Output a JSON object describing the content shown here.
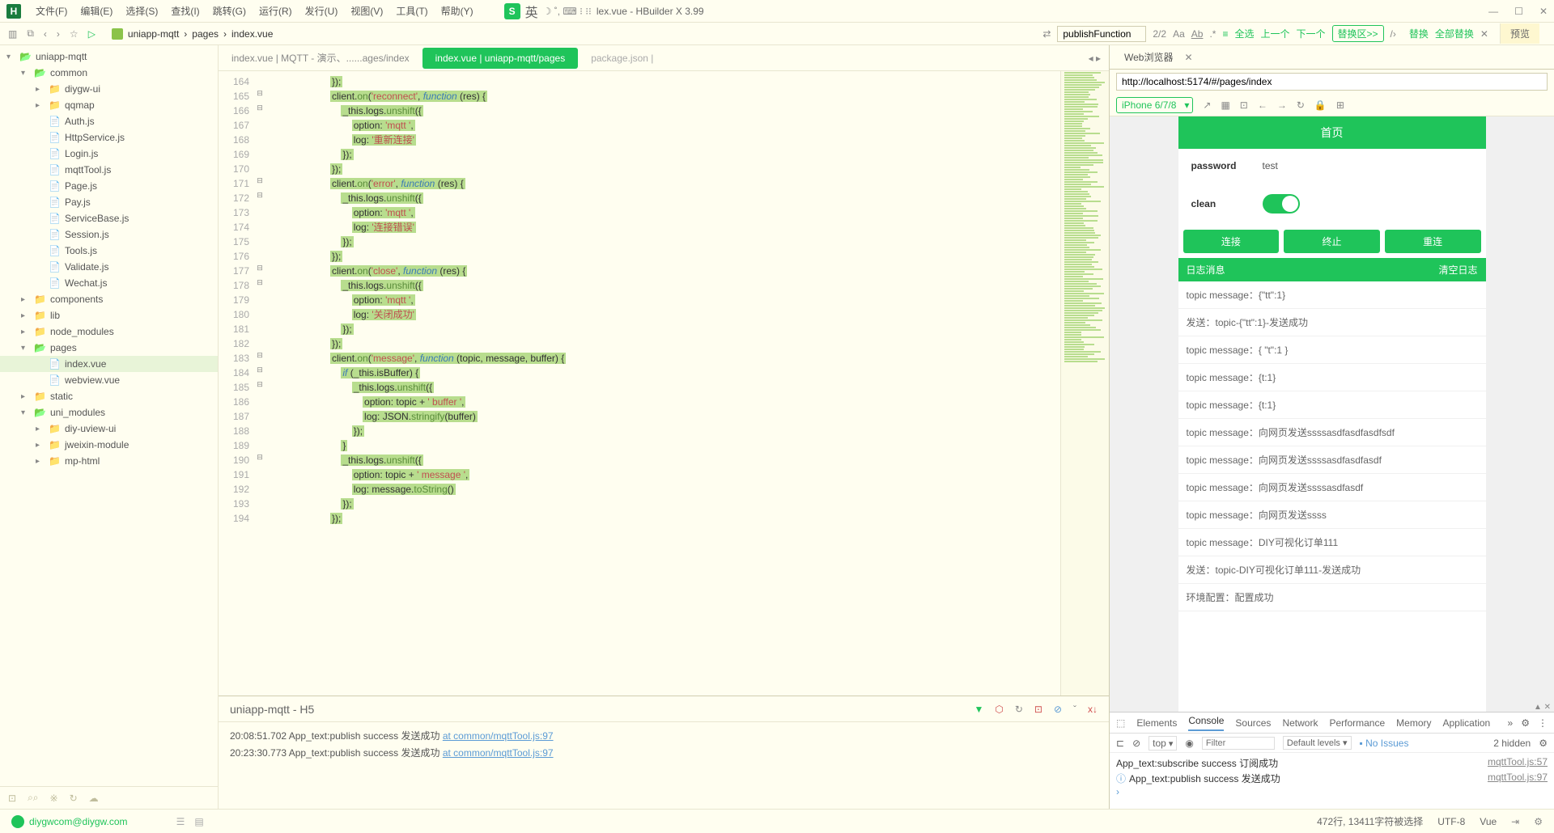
{
  "window": {
    "title": "lex.vue - HBuilder X 3.99"
  },
  "menus": [
    "文件(F)",
    "编辑(E)",
    "选择(S)",
    "查找(I)",
    "跳转(G)",
    "运行(R)",
    "发行(U)",
    "视图(V)",
    "工具(T)",
    "帮助(Y)"
  ],
  "ime": {
    "icon": "S",
    "lang": "英",
    "extras": "☽ ˚, ⌨ ⁝ ⁝⁝"
  },
  "breadcrumb": [
    "uniapp-mqtt",
    "pages",
    "index.vue"
  ],
  "find": {
    "term": "publishFunction",
    "count": "2/2",
    "ops": [
      "全选",
      "上一个",
      "下一个"
    ],
    "replace": "替换区>>",
    "actions": [
      "替换",
      "全部替换"
    ],
    "preview": "预览"
  },
  "tree": [
    {
      "d": 0,
      "c": "▾",
      "t": "folder-open",
      "l": "uniapp-mqtt"
    },
    {
      "d": 1,
      "c": "▾",
      "t": "folder-open",
      "l": "common"
    },
    {
      "d": 2,
      "c": "▸",
      "t": "folder-closed",
      "l": "diygw-ui"
    },
    {
      "d": 2,
      "c": "▸",
      "t": "folder-closed",
      "l": "qqmap"
    },
    {
      "d": 2,
      "c": "",
      "t": "file-js",
      "l": "Auth.js"
    },
    {
      "d": 2,
      "c": "",
      "t": "file-js",
      "l": "HttpService.js"
    },
    {
      "d": 2,
      "c": "",
      "t": "file-js",
      "l": "Login.js"
    },
    {
      "d": 2,
      "c": "",
      "t": "file-js",
      "l": "mqttTool.js"
    },
    {
      "d": 2,
      "c": "",
      "t": "file-js",
      "l": "Page.js"
    },
    {
      "d": 2,
      "c": "",
      "t": "file-js",
      "l": "Pay.js"
    },
    {
      "d": 2,
      "c": "",
      "t": "file-js",
      "l": "ServiceBase.js"
    },
    {
      "d": 2,
      "c": "",
      "t": "file-js",
      "l": "Session.js"
    },
    {
      "d": 2,
      "c": "",
      "t": "file-js",
      "l": "Tools.js"
    },
    {
      "d": 2,
      "c": "",
      "t": "file-js",
      "l": "Validate.js"
    },
    {
      "d": 2,
      "c": "",
      "t": "file-js",
      "l": "Wechat.js"
    },
    {
      "d": 1,
      "c": "▸",
      "t": "folder-closed",
      "l": "components"
    },
    {
      "d": 1,
      "c": "▸",
      "t": "folder-closed",
      "l": "lib"
    },
    {
      "d": 1,
      "c": "▸",
      "t": "folder-closed",
      "l": "node_modules"
    },
    {
      "d": 1,
      "c": "▾",
      "t": "folder-open",
      "l": "pages"
    },
    {
      "d": 2,
      "c": "",
      "t": "file-vue",
      "l": "index.vue",
      "active": true
    },
    {
      "d": 2,
      "c": "",
      "t": "file-vue",
      "l": "webview.vue"
    },
    {
      "d": 1,
      "c": "▸",
      "t": "folder-closed",
      "l": "static"
    },
    {
      "d": 1,
      "c": "▾",
      "t": "folder-open",
      "l": "uni_modules"
    },
    {
      "d": 2,
      "c": "▸",
      "t": "folder-closed",
      "l": "diy-uview-ui"
    },
    {
      "d": 2,
      "c": "▸",
      "t": "folder-closed",
      "l": "jweixin-module"
    },
    {
      "d": 2,
      "c": "▸",
      "t": "folder-closed",
      "l": "mp-html"
    }
  ],
  "tabs": [
    {
      "label": "index.vue | MQTT - 演示、......ages/index",
      "active": false
    },
    {
      "label": "index.vue | uniapp-mqtt/pages",
      "active": true
    },
    {
      "label": "package.json | ",
      "active": false,
      "muted": true
    }
  ],
  "code": {
    "start": 164,
    "lines": [
      {
        "n": 164,
        "f": "",
        "t": "                        });"
      },
      {
        "n": 165,
        "f": "⊟",
        "t": "                        client.on('reconnect', function (res) {"
      },
      {
        "n": 166,
        "f": "⊟",
        "t": "                            _this.logs.unshift({"
      },
      {
        "n": 167,
        "f": "",
        "t": "                                option: 'mqtt ',"
      },
      {
        "n": 168,
        "f": "",
        "t": "                                log: '重新连接'"
      },
      {
        "n": 169,
        "f": "",
        "t": "                            });"
      },
      {
        "n": 170,
        "f": "",
        "t": "                        });"
      },
      {
        "n": 171,
        "f": "⊟",
        "t": "                        client.on('error', function (res) {"
      },
      {
        "n": 172,
        "f": "⊟",
        "t": "                            _this.logs.unshift({"
      },
      {
        "n": 173,
        "f": "",
        "t": "                                option: 'mqtt ',"
      },
      {
        "n": 174,
        "f": "",
        "t": "                                log: '连接错误'"
      },
      {
        "n": 175,
        "f": "",
        "t": "                            });"
      },
      {
        "n": 176,
        "f": "",
        "t": "                        });"
      },
      {
        "n": 177,
        "f": "⊟",
        "t": "                        client.on('close', function (res) {"
      },
      {
        "n": 178,
        "f": "⊟",
        "t": "                            _this.logs.unshift({"
      },
      {
        "n": 179,
        "f": "",
        "t": "                                option: 'mqtt ',"
      },
      {
        "n": 180,
        "f": "",
        "t": "                                log: '关闭成功'"
      },
      {
        "n": 181,
        "f": "",
        "t": "                            });"
      },
      {
        "n": 182,
        "f": "",
        "t": "                        });"
      },
      {
        "n": 183,
        "f": "⊟",
        "t": "                        client.on('message', function (topic, message, buffer) {"
      },
      {
        "n": 184,
        "f": "⊟",
        "t": "                            if (_this.isBuffer) {"
      },
      {
        "n": 185,
        "f": "⊟",
        "t": "                                _this.logs.unshift({"
      },
      {
        "n": 186,
        "f": "",
        "t": "                                    option: topic + ' buffer ',"
      },
      {
        "n": 187,
        "f": "",
        "t": "                                    log: JSON.stringify(buffer)"
      },
      {
        "n": 188,
        "f": "",
        "t": "                                });"
      },
      {
        "n": 189,
        "f": "",
        "t": "                            }"
      },
      {
        "n": 190,
        "f": "⊟",
        "t": "                            _this.logs.unshift({"
      },
      {
        "n": 191,
        "f": "",
        "t": "                                option: topic + ' message ',"
      },
      {
        "n": 192,
        "f": "",
        "t": "                                log: message.toString()"
      },
      {
        "n": 193,
        "f": "",
        "t": "                            });"
      },
      {
        "n": 194,
        "f": "",
        "t": "                        });"
      }
    ]
  },
  "browser": {
    "tab": "Web浏览器",
    "url": "http://localhost:5174/#/pages/index",
    "device": "iPhone 6/7/8"
  },
  "phone": {
    "title": "首页",
    "password_lbl": "password",
    "password_val": "test",
    "clean_lbl": "clean",
    "btns": [
      "连接",
      "终止",
      "重连"
    ],
    "log_hdr": "日志消息",
    "log_clear": "清空日志",
    "logs": [
      "topic message：{\"tt\":1}",
      "发送：topic-{\"tt\":1}-发送成功",
      "topic message：{ \"t\":1 }",
      "topic message：{t:1}",
      "topic message：{t:1}",
      "topic message：向网页发送ssssasdfasdfasdfsdf",
      "topic message：向网页发送ssssasdfasdfasdf",
      "topic message：向网页发送ssssasdfasdf",
      "topic message：向网页发送ssss",
      "topic message：DIY可视化订单111",
      "发送：topic-DIY可视化订单111-发送成功",
      "环境配置：配置成功"
    ]
  },
  "devtools": {
    "tabs": [
      "Elements",
      "Console",
      "Sources",
      "Network",
      "Performance",
      "Memory",
      "Application"
    ],
    "active": "Console",
    "filter_top": "top",
    "filter_ph": "Filter",
    "levels": "Default levels ▾",
    "issues": "No Issues",
    "hidden": "2 hidden",
    "lines": [
      {
        "icon": "",
        "text": "App_text:subscribe success 订阅成功",
        "src": "mqttTool.js:57"
      },
      {
        "icon": "ⓘ",
        "text": "App_text:publish success 发送成功",
        "src": "mqttTool.js:97"
      }
    ],
    "prompt": "›"
  },
  "console": {
    "title": "uniapp-mqtt - H5",
    "lines": [
      {
        "ts": "20:08:51.702",
        "msg": "App_text:publish success 发送成功",
        "src": "at common/mqttTool.js:97"
      },
      {
        "ts": "20:23:30.773",
        "msg": "App_text:publish success 发送成功",
        "src": "at common/mqttTool.js:97"
      }
    ]
  },
  "status": {
    "email": "diygwcom@diygw.com",
    "pos": "472行, 13411字符被选择",
    "enc": "UTF-8",
    "lang": "Vue"
  }
}
